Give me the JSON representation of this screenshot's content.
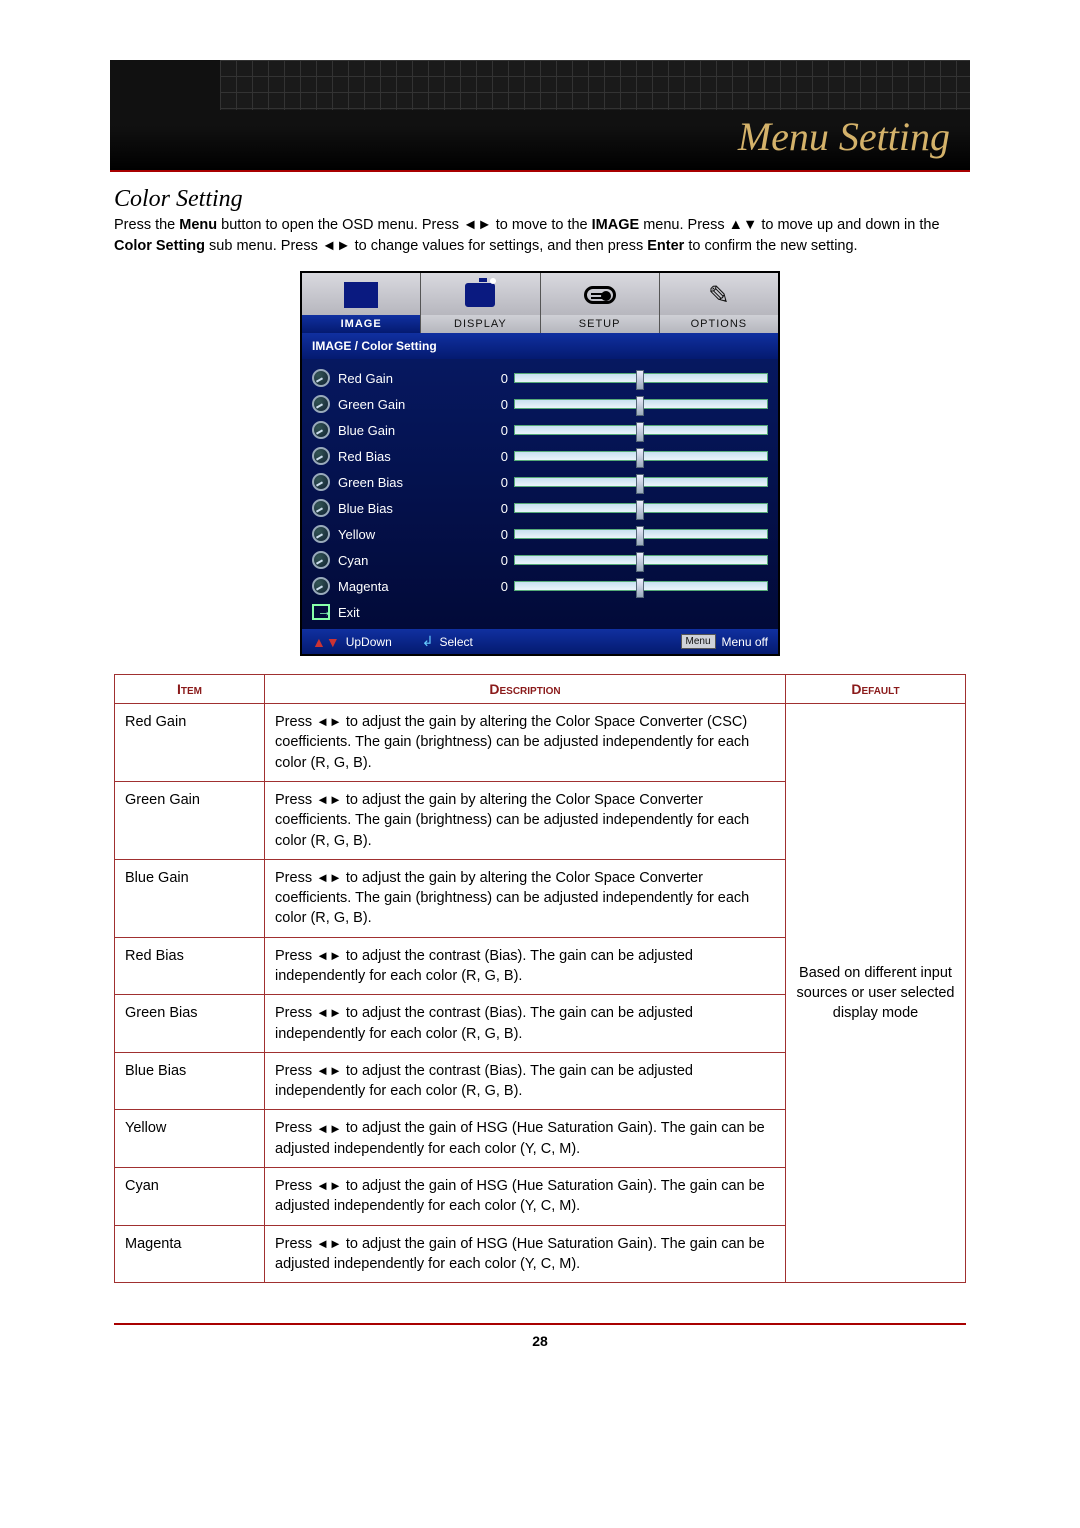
{
  "banner": {
    "title": "Menu Setting"
  },
  "section": {
    "title": "Color Setting"
  },
  "intro": {
    "p1a": "Press the ",
    "menu": "Menu",
    "p1b": " button to open the OSD menu. Press ",
    "lr1": "◄►",
    "p1c": " to move to the ",
    "image": "IMAGE",
    "p1d": " menu. Press ",
    "ud1": "▲▼",
    "p2a": "to move up and down in the ",
    "cs": "Color Setting",
    "p2b": " sub menu. Press ",
    "lr2": "◄►",
    "p2c": " to change values for settings, and then press ",
    "enter": "Enter",
    "p2d": " to confirm the new setting."
  },
  "osd": {
    "tabs": [
      "IMAGE",
      "DISPLAY",
      "SETUP",
      "OPTIONS"
    ],
    "subheader": "IMAGE / Color Setting",
    "rows": [
      {
        "label": "Red Gain",
        "value": "0"
      },
      {
        "label": "Green Gain",
        "value": "0"
      },
      {
        "label": "Blue Gain",
        "value": "0"
      },
      {
        "label": "Red Bias",
        "value": "0"
      },
      {
        "label": "Green Bias",
        "value": "0"
      },
      {
        "label": "Blue Bias",
        "value": "0"
      },
      {
        "label": "Yellow",
        "value": "0"
      },
      {
        "label": "Cyan",
        "value": "0"
      },
      {
        "label": "Magenta",
        "value": "0"
      }
    ],
    "exit": "Exit",
    "footer": {
      "updown": "UpDown",
      "select": "Select",
      "menu_badge": "Menu",
      "menuoff": "Menu off"
    }
  },
  "spec": {
    "headers": {
      "item": "Item",
      "desc": "Description",
      "def": "Default"
    },
    "arrow_text": "◄►",
    "rows": [
      {
        "item": "Red Gain",
        "desc_a": "Press ",
        "desc_b": " to adjust the gain by altering the Color Space Converter (CSC) coefficients. The gain (brightness) can be adjusted independently for each color (R, G, B)."
      },
      {
        "item": "Green Gain",
        "desc_a": "Press ",
        "desc_b": " to adjust the gain by altering the Color Space Converter coefficients. The gain (brightness) can be adjusted independently for each color (R, G, B)."
      },
      {
        "item": "Blue Gain",
        "desc_a": "Press ",
        "desc_b": " to adjust the gain by altering the Color Space Converter coefficients. The gain (brightness) can be adjusted independently for each color (R, G, B)."
      },
      {
        "item": "Red Bias",
        "desc_a": "Press ",
        "desc_b": " to adjust the contrast (Bias). The gain can be adjusted independently for each color (R, G, B)."
      },
      {
        "item": "Green Bias",
        "desc_a": "Press ",
        "desc_b": " to adjust the contrast (Bias). The gain can be adjusted independently for each color (R, G, B)."
      },
      {
        "item": "Blue Bias",
        "desc_a": "Press ",
        "desc_b": " to adjust the contrast (Bias). The gain can be adjusted independently for each color (R, G, B)."
      },
      {
        "item": "Yellow",
        "desc_a": "Press ",
        "desc_b": " to adjust the gain of HSG (Hue Saturation Gain). The gain can be adjusted independently for each color (Y, C, M)."
      },
      {
        "item": "Cyan",
        "desc_a": "Press ",
        "desc_b": " to adjust the gain of HSG (Hue Saturation Gain). The gain can be adjusted independently for each color (Y, C, M)."
      },
      {
        "item": "Magenta",
        "desc_a": "Press ",
        "desc_b": " to adjust the gain of HSG (Hue Saturation Gain). The gain can be adjusted independently for each color (Y, C, M)."
      }
    ],
    "default_text": "Based on different input sources or user selected display mode"
  },
  "page_number": "28"
}
